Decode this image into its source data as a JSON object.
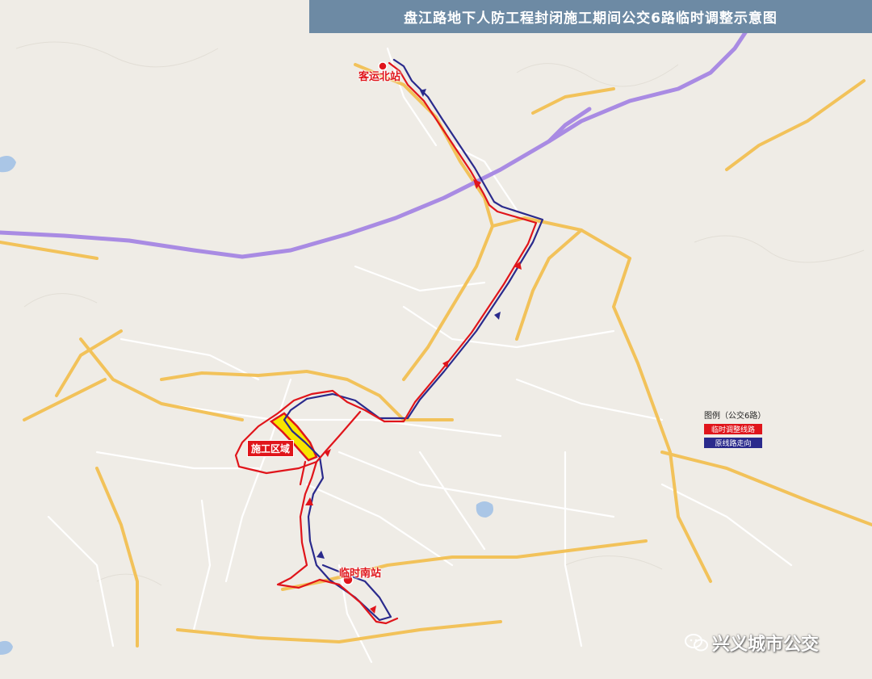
{
  "header": {
    "title": "盘江路地下人防工程封闭施工期间公交6路临时调整示意图"
  },
  "stops": {
    "north": "客运北站",
    "south": "临时南站"
  },
  "zone": {
    "label": "施工区域"
  },
  "legend": {
    "title": "图例（公交6路）",
    "items": [
      {
        "label": "临时调整线路",
        "color": "#e0151b"
      },
      {
        "label": "原线路走向",
        "color": "#2a2a8c"
      }
    ]
  },
  "watermark": {
    "text": "兴义城市公交"
  },
  "colors": {
    "map_bg": "#efece6",
    "highway": "#a78be0",
    "arterial": "#f2c25a",
    "local_road": "#ffffff",
    "title_bar": "#6d8aa4"
  }
}
